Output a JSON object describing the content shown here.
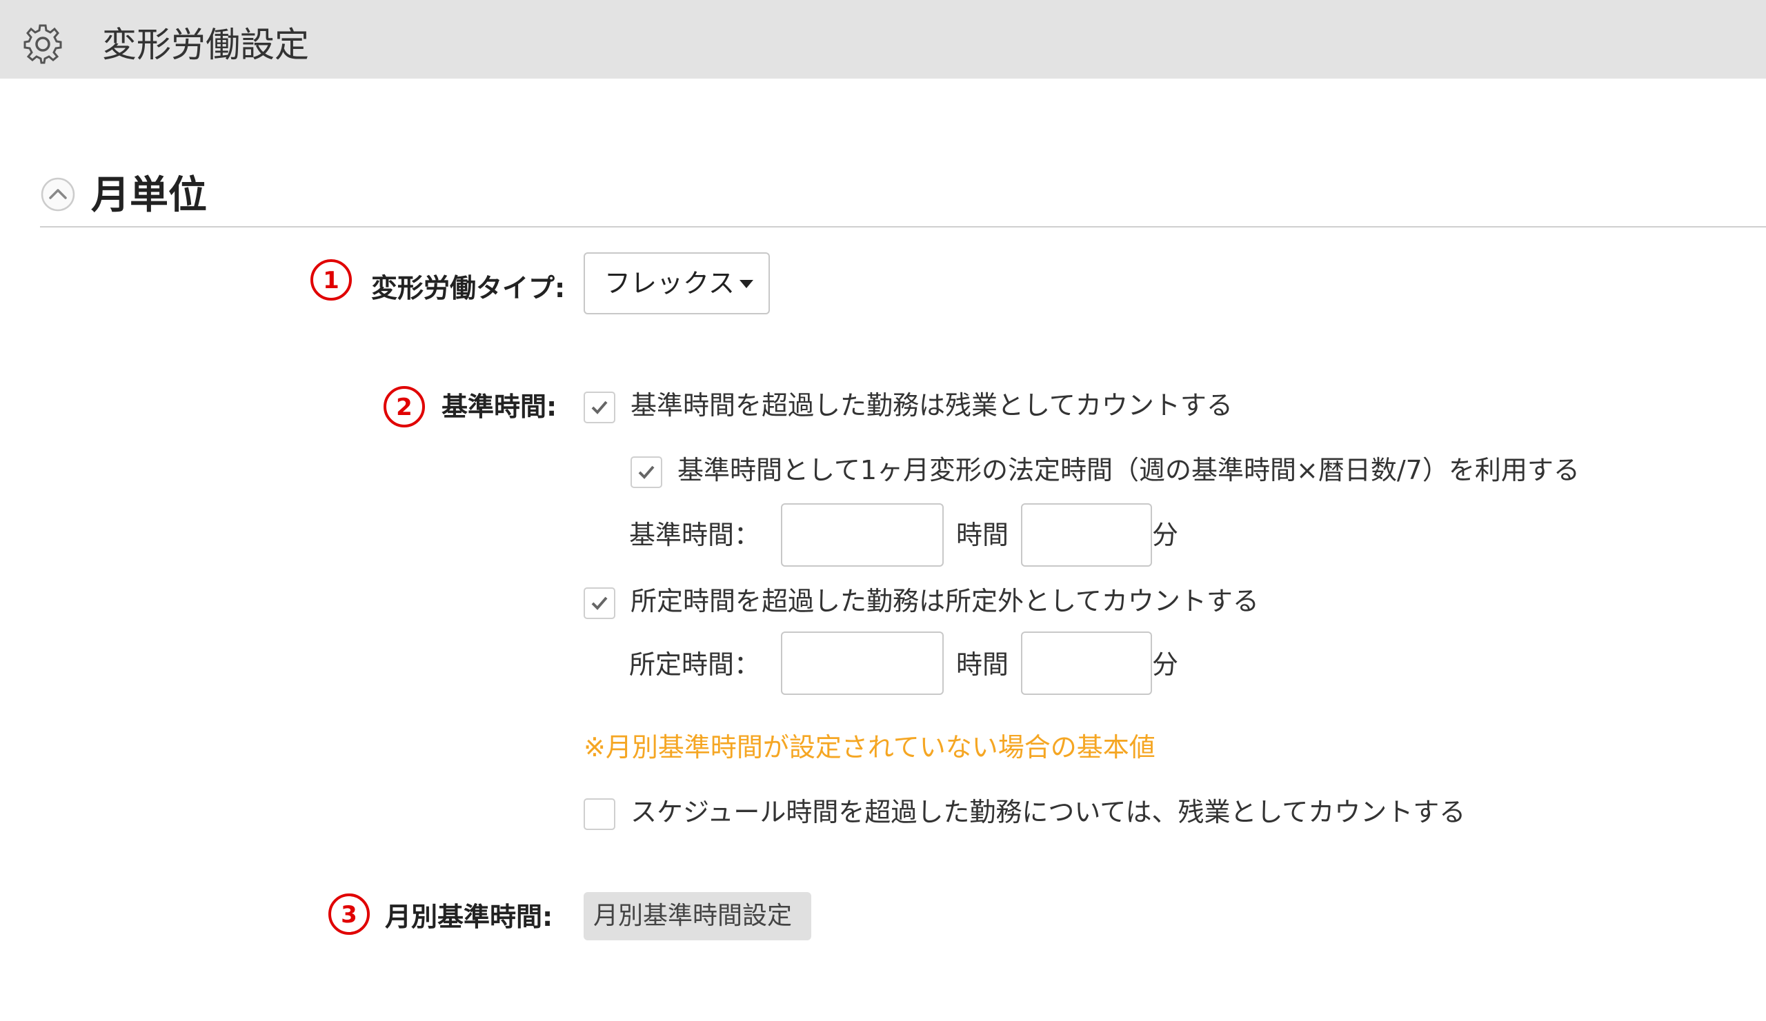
{
  "header": {
    "title": "変形労働設定",
    "icon": "gear-icon"
  },
  "section": {
    "title": "月単位",
    "toggle_icon": "chevron-up-icon"
  },
  "markers": [
    "①",
    "②",
    "③"
  ],
  "colors": {
    "marker": "#e00000",
    "note": "#f5a623",
    "header_bg": "#e3e3e3"
  },
  "type_row": {
    "label": "変形労働タイプ:",
    "selected": "フレックス"
  },
  "standard": {
    "label": "基準時間:",
    "exceed_overtime": {
      "checked": true,
      "label": "基準時間を超過した勤務は残業としてカウントする"
    },
    "use_legal": {
      "checked": true,
      "label": "基準時間として1ヶ月変形の法定時間（週の基準時間×暦日数/7）を利用する"
    },
    "time_label": "基準時間：",
    "hours_unit": "時間",
    "minutes_unit": "分",
    "hours_value": "",
    "minutes_value": ""
  },
  "prescribed": {
    "exceed_outside": {
      "checked": true,
      "label": "所定時間を超過した勤務は所定外としてカウントする"
    },
    "time_label": "所定時間：",
    "hours_unit": "時間",
    "minutes_unit": "分",
    "hours_value": "",
    "minutes_value": ""
  },
  "note": "※月別基準時間が設定されていない場合の基本値",
  "schedule_overtime": {
    "checked": false,
    "label": "スケジュール時間を超過した勤務については、残業としてカウントする"
  },
  "monthly": {
    "label": "月別基準時間:",
    "button": "月別基準時間設定"
  }
}
